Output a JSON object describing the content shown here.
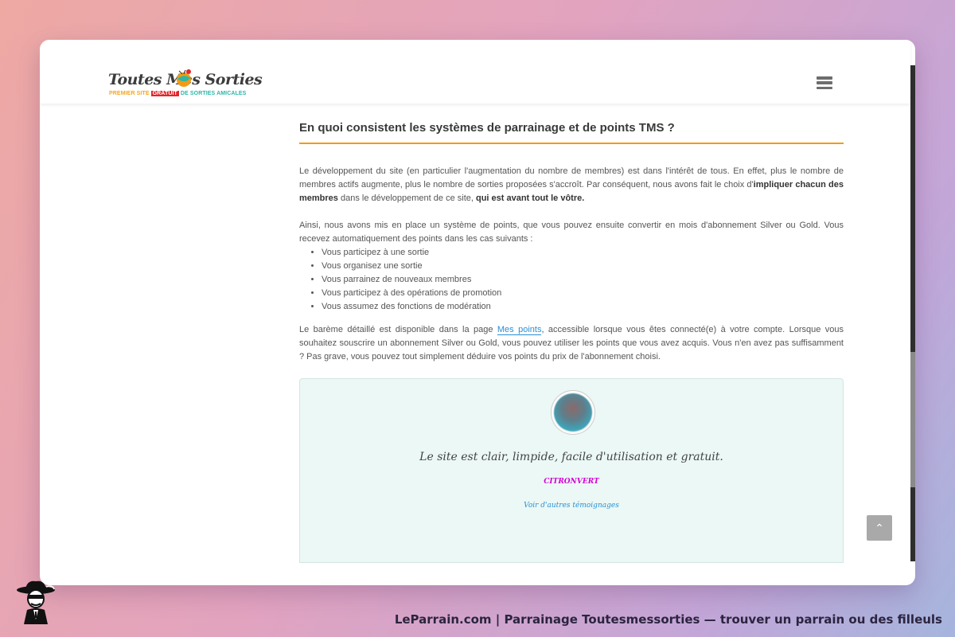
{
  "logo": {
    "title": "Toutes Mes Sorties",
    "tagline_a": "PREMIER SITE",
    "tagline_b": "GRATUIT",
    "tagline_c": "DE SORTIES AMICALES"
  },
  "header": {
    "menu_icon": "hamburger-icon"
  },
  "section": {
    "title": "En quoi consistent les systèmes de parrainage et de points TMS ?"
  },
  "paragraph1": {
    "text_a": "Le développement du site (en particulier l'augmentation du nombre de membres) est dans l'intérêt de tous. En effet, plus le nombre de membres actifs augmente, plus le nombre de sorties proposées s'accroît. Par conséquent, nous avons fait le choix d'",
    "bold_a": "impliquer chacun des membres",
    "text_b": " dans le développement de ce site, ",
    "bold_b": "qui est avant tout le vôtre."
  },
  "paragraph2": {
    "text": "Ainsi, nous avons mis en place un système de points, que vous pouvez ensuite convertir en mois d'abonnement Silver ou Gold. Vous recevez automatiquement des points dans les cas suivants :"
  },
  "bullets": [
    "Vous participez à une sortie",
    "Vous organisez une sortie",
    "Vous parrainez de nouveaux membres",
    "Vous participez à des opérations de promotion",
    "Vous assumez des fonctions de modération"
  ],
  "paragraph3": {
    "text_a": "Le barème détaillé est disponible dans la page ",
    "link": "Mes points",
    "text_b": ", accessible lorsque vous êtes connecté(e) à votre compte. Lorsque vous souhaitez souscrire un abonnement Silver ou Gold, vous pouvez utiliser les points que vous avez acquis. Vous n'en avez pas suffisamment ? Pas grave, vous pouvez tout simplement déduire vos points du prix de l'abonnement choisi."
  },
  "testimonial": {
    "quote": "Le site est clair, limpide, facile d'utilisation et gratuit.",
    "author": "CITRONVERT",
    "more_link": "Voir d'autres témoignages"
  },
  "back_to_top": {
    "icon": "chevron-up-icon",
    "glyph": "⌃"
  },
  "footer": {
    "caption": "LeParrain.com | Parrainage Toutesmessorties — trouver un parrain ou des filleuls"
  },
  "colors": {
    "accent_underline": "#f39c12",
    "link": "#2a8fd6",
    "author": "#d400d4",
    "testimonial_bg": "#ebf8f5"
  }
}
